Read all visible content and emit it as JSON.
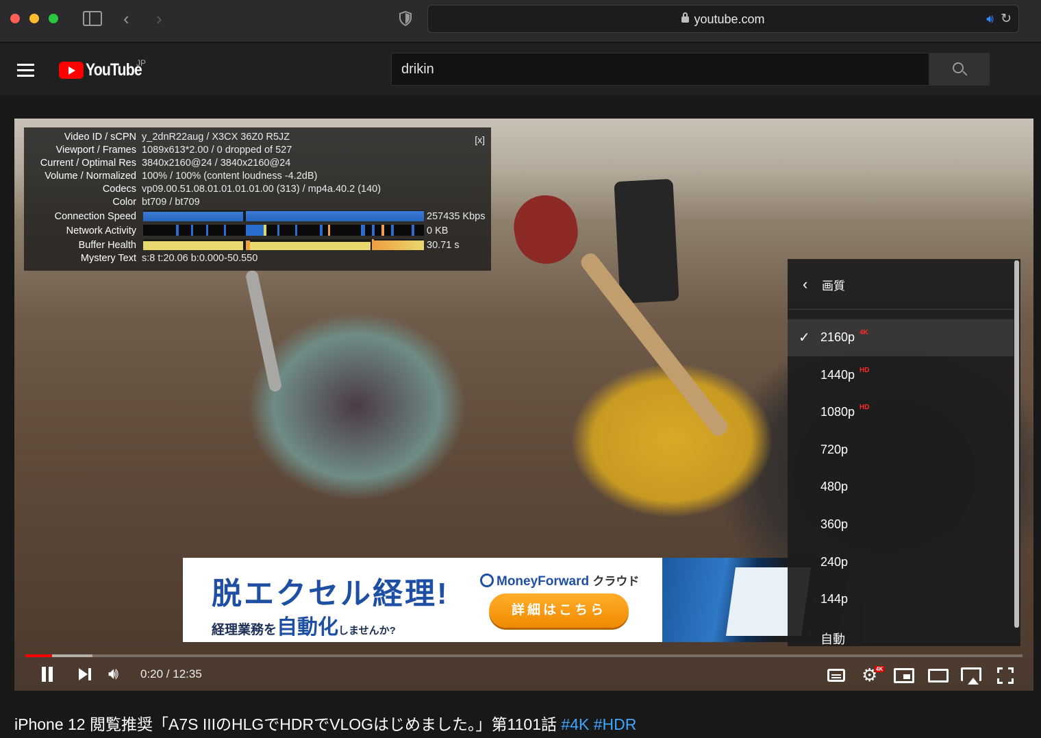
{
  "browser": {
    "url": "youtube.com"
  },
  "header": {
    "logo_text": "YouTube",
    "region": "JP",
    "search_value": "drikin"
  },
  "stats": {
    "close_label": "[x]",
    "rows": [
      {
        "label": "Video ID / sCPN",
        "value": "y_2dnR22aug / X3CX 36Z0 R5JZ"
      },
      {
        "label": "Viewport / Frames",
        "value": "1089x613*2.00 / 0 dropped of 527"
      },
      {
        "label": "Current / Optimal Res",
        "value": "3840x2160@24 / 3840x2160@24"
      },
      {
        "label": "Volume / Normalized",
        "value": "100% / 100% (content loudness -4.2dB)"
      },
      {
        "label": "Codecs",
        "value": "vp09.00.51.08.01.01.01.01.00 (313) / mp4a.40.2 (140)"
      },
      {
        "label": "Color",
        "value": "bt709 / bt709"
      }
    ],
    "graphs": [
      {
        "label": "Connection Speed",
        "value": "257435 Kbps"
      },
      {
        "label": "Network Activity",
        "value": "0 KB"
      },
      {
        "label": "Buffer Health",
        "value": "30.71 s"
      }
    ],
    "mystery": {
      "label": "Mystery Text",
      "value": "s:8 t:20.06 b:0.000-50.550"
    }
  },
  "quality_menu": {
    "title": "画質",
    "items": [
      {
        "label": "2160p",
        "badge": "4K",
        "selected": true
      },
      {
        "label": "1440p",
        "badge": "HD",
        "selected": false
      },
      {
        "label": "1080p",
        "badge": "HD",
        "selected": false
      },
      {
        "label": "720p",
        "badge": "",
        "selected": false
      },
      {
        "label": "480p",
        "badge": "",
        "selected": false
      },
      {
        "label": "360p",
        "badge": "",
        "selected": false
      },
      {
        "label": "240p",
        "badge": "",
        "selected": false
      },
      {
        "label": "144p",
        "badge": "",
        "selected": false
      },
      {
        "label": "自動",
        "badge": "",
        "selected": false
      }
    ]
  },
  "ad": {
    "headline": "脱エクセル経理!",
    "sub_pre": "経理業務を",
    "sub_emph": "自動化",
    "sub_post": "しませんか?",
    "brand": "MoneyForward",
    "brand_suffix": "クラウド",
    "cta": "詳細はこちら"
  },
  "player": {
    "time": "0:20 / 12:35",
    "progress_played": 0.027,
    "progress_buffered": 0.067,
    "settings_badge": "4K"
  },
  "video": {
    "title": "iPhone 12 閲覧推奨「A7S IIIのHLGでHDRでVLOGはじめました。」第1101話",
    "hashtags": "#4K #HDR"
  },
  "colors": {
    "accent_red": "#ff0000",
    "hashtag_blue": "#3ea6ff",
    "ad_blue": "#1f4fa3",
    "ad_orange": "#f08a00"
  }
}
